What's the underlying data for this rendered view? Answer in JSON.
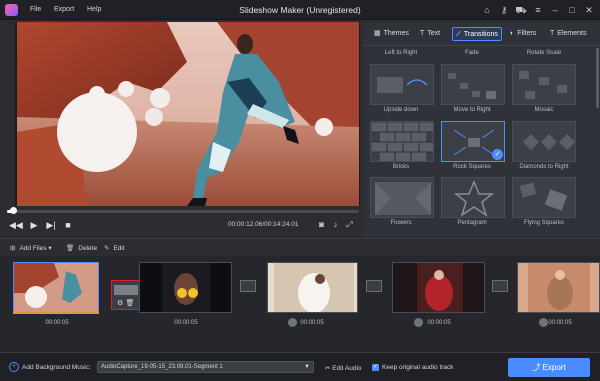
{
  "app": {
    "title": "Slideshow Maker (Unregistered)",
    "menu": [
      "File",
      "Export",
      "Help"
    ]
  },
  "preview": {
    "timecode": "00:00:12.06/00:14:24.01",
    "progress_fraction": 0.015
  },
  "right_panel": {
    "tabs": [
      {
        "label": "Themes",
        "icon": "themes-icon"
      },
      {
        "label": "Text",
        "icon": "text-icon"
      },
      {
        "label": "Transitions",
        "icon": "transitions-icon"
      },
      {
        "label": "Filters",
        "icon": "filters-icon"
      },
      {
        "label": "Elements",
        "icon": "elements-icon"
      }
    ],
    "active_tab": "Transitions",
    "top_labels": [
      "Left to Right",
      "Fade",
      "Rotate Scale"
    ],
    "transitions": [
      "Upside down",
      "Move to Right",
      "Mosaic",
      "Bricks",
      "Rock Squares",
      "Diamonds to Right",
      "Flowers",
      "Pentagram",
      "Flying Squares"
    ],
    "selected_transition": "Rock Squares"
  },
  "toolbar": {
    "add_files": "Add Files",
    "delete": "Delete",
    "edit": "Edit"
  },
  "storyboard": {
    "durations": [
      "00:00:05",
      "00:00:05",
      "00:00:05",
      "00:00:05",
      "00:00:05"
    ]
  },
  "bottom": {
    "bgm_label": "Add Background Music:",
    "bgm_value": "AudioCapture_19-05-15_23.09.01-Segment 1",
    "edit_audio": "Edit Audio",
    "keep_audio": "Keep original audio track",
    "export": "Export"
  },
  "colors": {
    "accent": "#4a8cff",
    "selected_transition_border": "#e11d1d",
    "background": "#2b2d33"
  }
}
